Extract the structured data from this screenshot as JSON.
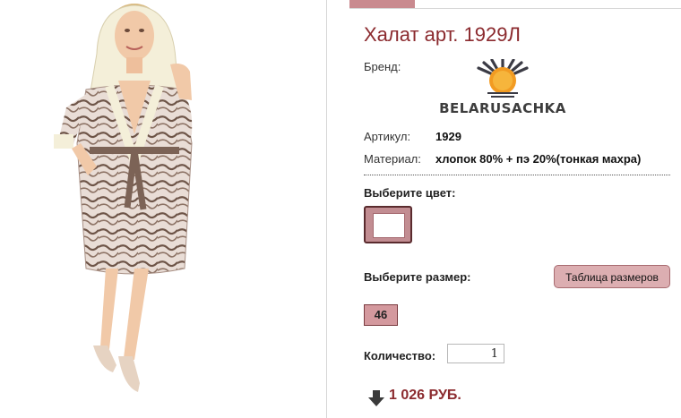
{
  "product": {
    "title": "Халат арт. 1929Л",
    "image_alt": "woman-in-hooded-bathrobe",
    "brand_label": "Бренд:",
    "brand_name": "BELARUSACHKA",
    "article_label": "Артикул:",
    "article_value": "1929",
    "material_label": "Материал:",
    "material_value": "хлопок 80% + пэ 20%(тонкая махра)"
  },
  "options": {
    "color_label": "Выберите цвет:",
    "size_label": "Выберите размер:",
    "size_table_button": "Таблица размеров",
    "sizes": [
      "46"
    ],
    "quantity_label": "Количество:",
    "quantity_value": "1"
  },
  "price": {
    "value": "1 026 РУБ.",
    "icon": "arrow-down-icon"
  },
  "colors": {
    "accent": "#8b2a2e",
    "swatch": "#c28d92",
    "tab_active": "#c98a8f"
  }
}
